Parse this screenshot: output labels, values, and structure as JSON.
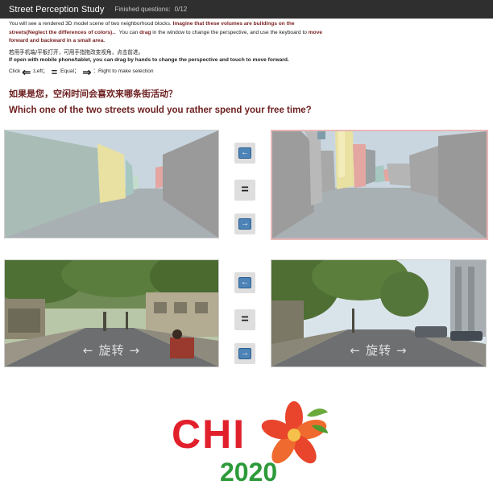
{
  "header": {
    "title": "Street Perception Study",
    "progress_label": "Finished questions:",
    "progress_value": "0/12"
  },
  "instructions": {
    "l1_a": "You will see a rendered 3D model scene of two neighborhood blocks. ",
    "l1_b": "Imagine that these volumes are buildings on the streets(Neglect the differences of colors).",
    "l1_c": "、You can ",
    "l1_d": "drag",
    "l1_e": " in the window to change the perspective, and use the keyboard to ",
    "l1_f": "move forward and backward in a small area.",
    "cn_mobile": "若用手机端/平板打开，可用手指拖改变视角，点击前进。",
    "en_mobile": "If open with mobile phone/tablet, you can drag by hands to change the perspective and touch to move forward.",
    "click_word": "Click",
    "left_sym": "⇐",
    "left_text": ":Left；",
    "equal_sym": "=",
    "equal_text": ":Equal；",
    "right_sym": "⇒",
    "right_text": "：Right to make selection"
  },
  "question": {
    "cn": "如果是您，空闲时间会喜欢来哪条街活动？",
    "en": "Which one of the two streets would you rather spend your free time?"
  },
  "buttons": {
    "left_glyph": "←",
    "equal_glyph": "=",
    "right_glyph": "→"
  },
  "panels": {
    "rotate_hint": "旋转",
    "arrow_left": "←",
    "arrow_right": "→"
  },
  "logo": {
    "chi": "CHI",
    "year": "2020"
  },
  "colors": {
    "header_bg": "#2f2f2f",
    "highlight_text": "#7a1f1f",
    "question_text": "#6d1f1f",
    "button_blue": "#4d83b6",
    "logo_red": "#e2202c",
    "logo_green": "#2d9a3a",
    "logo_flower": "#e8452c"
  }
}
